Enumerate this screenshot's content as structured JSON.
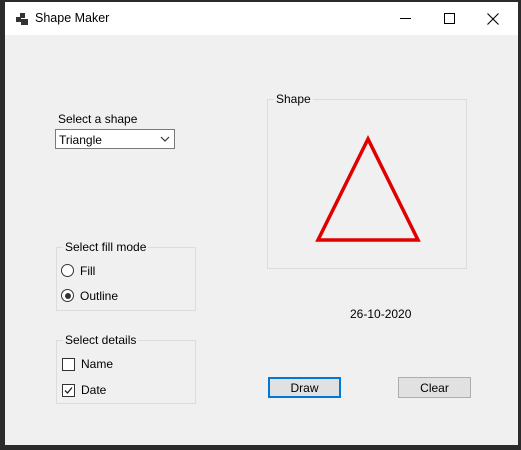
{
  "window": {
    "title": "Shape Maker",
    "app_icon": "app-icon",
    "controls": {
      "minimize_icon": "minimize-icon",
      "maximize_icon": "maximize-icon",
      "close_icon": "close-icon"
    }
  },
  "shape_select": {
    "label": "Select a shape",
    "selected": "Triangle",
    "dropdown_icon": "chevron-down-icon"
  },
  "fill_mode": {
    "title": "Select fill mode",
    "options": [
      {
        "label": "Fill",
        "checked": false
      },
      {
        "label": "Outline",
        "checked": true
      }
    ]
  },
  "details": {
    "title": "Select details",
    "options": [
      {
        "label": "Name",
        "checked": false
      },
      {
        "label": "Date",
        "checked": true
      }
    ]
  },
  "shape_panel": {
    "title": "Shape",
    "shape": "triangle",
    "mode": "outline",
    "stroke_color": "#e00000"
  },
  "date_text": "26-10-2020",
  "buttons": {
    "draw": "Draw",
    "clear": "Clear"
  },
  "colors": {
    "accent": "#0078d7",
    "background": "#f0f0f0",
    "titlebar": "#ffffff"
  }
}
